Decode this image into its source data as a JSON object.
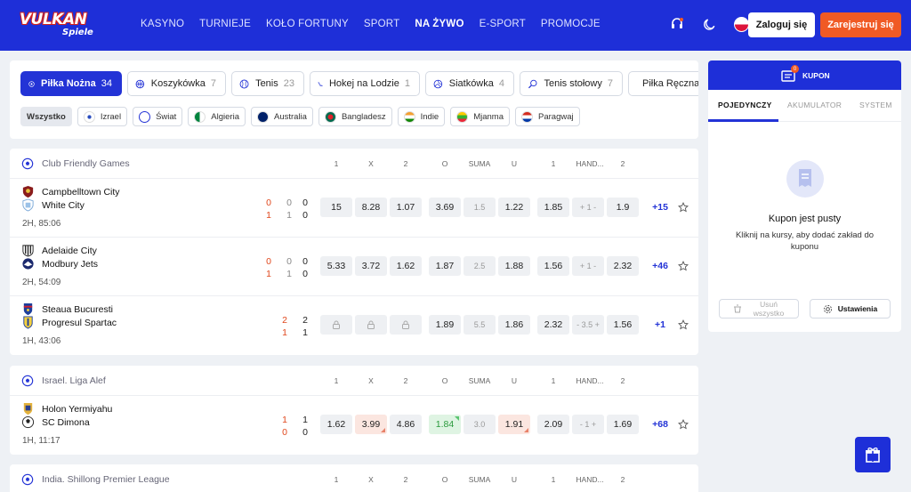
{
  "header": {
    "logo_top": "VULKAN",
    "logo_bottom": "Spiele",
    "nav": [
      "KASYNO",
      "TURNIEJE",
      "KOŁO FORTUNY",
      "SPORT",
      "NA ŻYWO",
      "E-SPORT",
      "PROMOCJE"
    ],
    "active_nav": "NA ŻYWO",
    "login_label": "Zaloguj się",
    "register_label": "Zarejestruj się",
    "brand_color": "#1e2fd8",
    "register_color": "#f05a24"
  },
  "sport_tabs": [
    {
      "label": "Piłka Nożna",
      "count": "34",
      "icon": "soccer-ball-icon",
      "active": true
    },
    {
      "label": "Koszykówka",
      "count": "7",
      "icon": "basketball-icon"
    },
    {
      "label": "Tenis",
      "count": "23",
      "icon": "tennis-ball-icon"
    },
    {
      "label": "Hokej na Lodzie",
      "count": "1",
      "icon": "hockey-stick-icon"
    },
    {
      "label": "Siatkówka",
      "count": "4",
      "icon": "volleyball-icon"
    },
    {
      "label": "Tenis stołowy",
      "count": "7",
      "icon": "table-tennis-icon"
    },
    {
      "label": "Piłka Ręczna",
      "count": "",
      "icon": "handball-icon"
    }
  ],
  "country_chips": [
    {
      "label": "Wszystko",
      "active": true
    },
    {
      "label": "Izrael",
      "flag": "israel-flag-icon"
    },
    {
      "label": "Świat",
      "flag": "world-icon"
    },
    {
      "label": "Algieria",
      "flag": "algeria-flag-icon"
    },
    {
      "label": "Australia",
      "flag": "australia-flag-icon"
    },
    {
      "label": "Bangladesz",
      "flag": "bangladesh-flag-icon"
    },
    {
      "label": "Indie",
      "flag": "india-flag-icon"
    },
    {
      "label": "Mjanma",
      "flag": "myanmar-flag-icon"
    },
    {
      "label": "Paragwaj",
      "flag": "paraguay-flag-icon"
    }
  ],
  "columns": [
    "1",
    "X",
    "2",
    "O",
    "SUMA",
    "U",
    "1",
    "HAND...",
    "2"
  ],
  "sections": [
    {
      "title": "Club Friendly Games",
      "matches": [
        {
          "home": "Campbelltown City",
          "away": "White City",
          "time": "2H, 85:06",
          "score_main": [
            "0",
            "1"
          ],
          "score_p1": [
            "0",
            "1"
          ],
          "score_p2": [
            "0",
            "0"
          ],
          "odds": [
            "15",
            "8.28",
            "1.07",
            "3.69",
            "1.5",
            "1.22",
            "1.85",
            "+ 1 -",
            "1.9"
          ],
          "more": "+15"
        },
        {
          "home": "Adelaide City",
          "away": "Modbury Jets",
          "time": "2H, 54:09",
          "score_main": [
            "0",
            "1"
          ],
          "score_p1": [
            "0",
            "1"
          ],
          "score_p2": [
            "0",
            "0"
          ],
          "odds": [
            "5.33",
            "3.72",
            "1.62",
            "1.87",
            "2.5",
            "1.88",
            "1.56",
            "+ 1 -",
            "2.32"
          ],
          "more": "+46"
        },
        {
          "home": "Steaua Bucuresti",
          "away": "Progresul Spartac",
          "time": "1H, 43:06",
          "score_main": [
            "2",
            "1"
          ],
          "score_p1": [
            "2",
            "1"
          ],
          "odds": [
            "",
            "",
            "",
            "1.89",
            "5.5",
            "1.86",
            "2.32",
            "- 3.5 +",
            "1.56"
          ],
          "locked": true,
          "more": "+1"
        }
      ]
    },
    {
      "title": "Israel. Liga Alef",
      "matches": [
        {
          "home": "Holon Yermiyahu",
          "away": "SC Dimona",
          "time": "1H, 11:17",
          "score_main": [
            "1",
            "0"
          ],
          "score_p1": [
            "1",
            "0"
          ],
          "odds": [
            "1.62",
            "3.99",
            "4.86",
            "1.84",
            "3.0",
            "1.91",
            "2.09",
            "- 1 +",
            "1.69"
          ],
          "more": "+68"
        }
      ]
    },
    {
      "title": "India. Shillong Premier League",
      "matches": []
    }
  ],
  "coupon": {
    "title": "KUPON",
    "badge": "0",
    "tabs": [
      "POJEDYNCZY",
      "AKUMULATOR",
      "SYSTEM"
    ],
    "empty_title": "Kupon jest pusty",
    "empty_sub": "Kliknij na kursy, aby dodać zakład do kuponu",
    "remove_all": "Usuń wszystko",
    "settings": "Ustawienia"
  }
}
